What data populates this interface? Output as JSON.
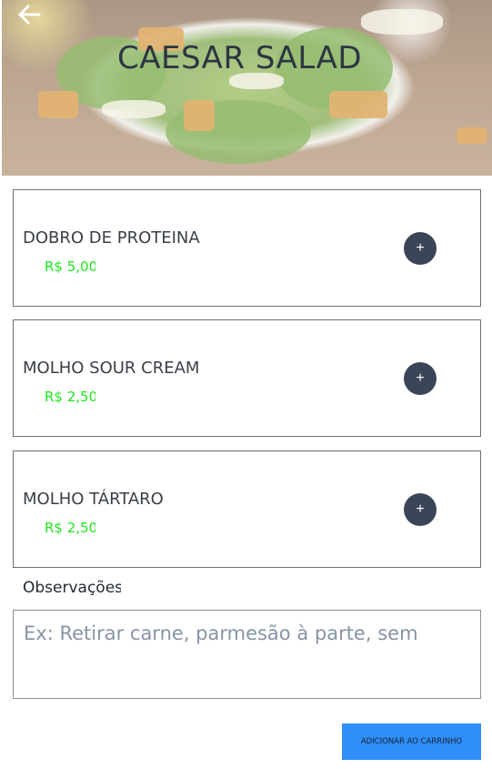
{
  "header": {
    "title": "CAESAR SALAD",
    "back_icon": "arrow-left-icon"
  },
  "addons": [
    {
      "name": "DOBRO DE PROTEINA",
      "price": "R$ 5,00",
      "button_label": "+"
    },
    {
      "name": "MOLHO SOUR CREAM",
      "price": "R$ 2,50",
      "button_label": "+"
    },
    {
      "name": "MOLHO TÁRTARO",
      "price": "R$ 2,50",
      "button_label": "+"
    }
  ],
  "observations": {
    "label": "Observações",
    "placeholder": "Ex: Retirar carne, parmesão à parte, sem"
  },
  "cart_button": {
    "label": "ADICIONAR AO CARRINHO"
  },
  "colors": {
    "title": "#2d3542",
    "price": "#1ee51e",
    "add_button": "#3a4657",
    "cart_button": "#2f8ef7"
  }
}
